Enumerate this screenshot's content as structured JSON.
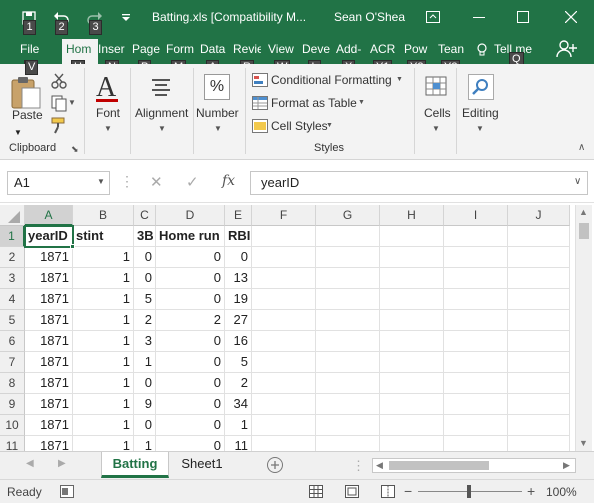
{
  "window": {
    "title": "Batting.xls  [Compatibility M...",
    "user": "Sean O'Shea",
    "qa_keytips": [
      "1",
      "2",
      "3"
    ],
    "restore_tooltip": "Ribbon Display Options"
  },
  "tabs": [
    {
      "label": "File",
      "keytip": "F"
    },
    {
      "label": "Hom",
      "keytip": "H"
    },
    {
      "label": "Inser",
      "keytip": "N"
    },
    {
      "label": "Page",
      "keytip": "P"
    },
    {
      "label": "Form",
      "keytip": "M"
    },
    {
      "label": "Data",
      "keytip": "A"
    },
    {
      "label": "Revie",
      "keytip": "R"
    },
    {
      "label": "View",
      "keytip": "W"
    },
    {
      "label": "Deve",
      "keytip": "L"
    },
    {
      "label": "Add-",
      "keytip": "X"
    },
    {
      "label": "ACR",
      "keytip": "Y1"
    },
    {
      "label": "Pow",
      "keytip": "Y2"
    },
    {
      "label": "Tean",
      "keytip": "Y3"
    },
    {
      "label": "Tell me",
      "keytip": "Q"
    }
  ],
  "ribbon": {
    "paste": "Paste",
    "clipboard": "Clipboard",
    "font": "Font",
    "alignment": "Alignment",
    "number_label": "Number",
    "number_symbol": "%",
    "conditional_formatting": "Conditional Formatting",
    "format_as_table": "Format as Table",
    "cell_styles": "Cell Styles",
    "styles": "Styles",
    "cells": "Cells",
    "editing": "Editing"
  },
  "formula_bar": {
    "name_box": "A1",
    "fx": "fx",
    "value": "yearID"
  },
  "grid": {
    "columns": [
      "A",
      "B",
      "C",
      "D",
      "E",
      "F",
      "G",
      "H",
      "I",
      "J"
    ],
    "rows": [
      "1",
      "2",
      "3",
      "4",
      "5",
      "6",
      "7",
      "8",
      "9",
      "10",
      "11"
    ],
    "header_row": [
      "yearID",
      "stint",
      "3B",
      "Home run",
      "RBI"
    ],
    "data": [
      [
        "1871",
        "1",
        "0",
        "0",
        "0"
      ],
      [
        "1871",
        "1",
        "0",
        "0",
        "13"
      ],
      [
        "1871",
        "1",
        "5",
        "0",
        "19"
      ],
      [
        "1871",
        "1",
        "2",
        "2",
        "27"
      ],
      [
        "1871",
        "1",
        "3",
        "0",
        "16"
      ],
      [
        "1871",
        "1",
        "1",
        "0",
        "5"
      ],
      [
        "1871",
        "1",
        "0",
        "0",
        "2"
      ],
      [
        "1871",
        "1",
        "9",
        "0",
        "34"
      ],
      [
        "1871",
        "1",
        "0",
        "0",
        "1"
      ],
      [
        "1871",
        "1",
        "1",
        "0",
        "11"
      ]
    ]
  },
  "sheets": {
    "tabs": [
      "Batting",
      "Sheet1"
    ],
    "active": "Batting"
  },
  "status": {
    "mode": "Ready",
    "zoom": "100%"
  },
  "colors": {
    "excel_green": "#217346",
    "keytip_bg": "#4a4a4a"
  }
}
